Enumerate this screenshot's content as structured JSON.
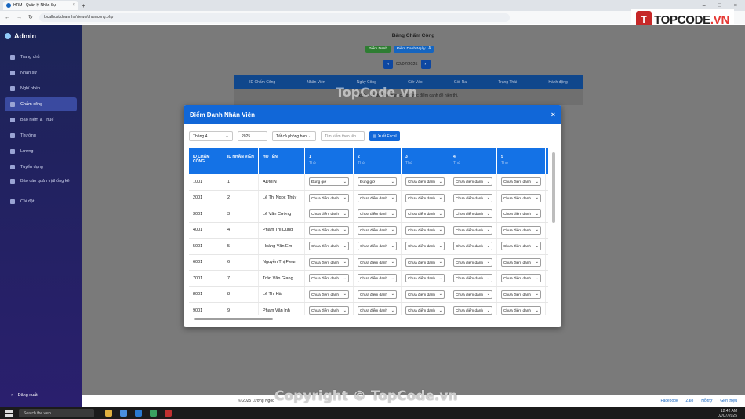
{
  "browser": {
    "tab_title": "HRM - Quản lý Nhân Sự",
    "url": "localhost/doannhs/views/chamcong.php"
  },
  "brand": {
    "logo_letter": "T",
    "text_a": "TOPCODE",
    "text_b": ".VN"
  },
  "sidebar": {
    "title": "Admin",
    "items": [
      {
        "label": "Trang chủ",
        "icon": "home-icon"
      },
      {
        "label": "Nhân sự",
        "icon": "users-icon"
      },
      {
        "label": "Nghỉ phép",
        "icon": "leave-icon"
      },
      {
        "label": "Chấm công",
        "icon": "calendar-icon",
        "active": true
      },
      {
        "label": "Bảo hiểm & Thuế",
        "icon": "insurance-icon"
      },
      {
        "label": "Thưởng",
        "icon": "gift-icon"
      },
      {
        "label": "Lương",
        "icon": "money-icon"
      },
      {
        "label": "Tuyển dụng",
        "icon": "recruit-icon"
      },
      {
        "label": "Báo cáo quản trị/thống kê",
        "icon": "chart-icon"
      },
      {
        "label": "Cài đặt",
        "icon": "gear-icon"
      }
    ],
    "logout": "Đăng xuất"
  },
  "page": {
    "title": "Bảng Chấm Công",
    "btn_attendance": "Điểm Danh",
    "btn_holiday": "Điểm Danh Ngày Lễ",
    "date": "02/07/2025",
    "bg_headers": [
      "ID Chấm Công",
      "Nhân Viên",
      "Ngày Công",
      "Giờ Vào",
      "Giờ Ra",
      "Trạng Thái",
      "Hành động"
    ],
    "bg_empty": "không có dữ liệu chấm công được điểm danh để hiển thị."
  },
  "modal": {
    "title": "Điểm Danh Nhân Viên",
    "close": "×",
    "month": "Tháng 4",
    "year": "2025",
    "department": "Tất cả phòng ban",
    "search_placeholder": "Tìm kiếm theo tên...",
    "export": "Xuất Excel",
    "headers": [
      "ID CHẤM CÔNG",
      "ID NHÂN VIÊN",
      "HỌ TÊN"
    ],
    "days": [
      {
        "day": "1",
        "wd": "Thứ"
      },
      {
        "day": "2",
        "wd": "Thứ"
      },
      {
        "day": "3",
        "wd": "Thứ"
      },
      {
        "day": "4",
        "wd": "Thứ"
      },
      {
        "day": "5",
        "wd": "Thứ"
      }
    ],
    "rows": [
      {
        "id": "1001",
        "emp": "1",
        "name": "ADMIN",
        "att": [
          "Đúng giờ",
          "Đúng giờ",
          "Chưa điểm danh",
          "Chưa điểm danh",
          "Chưa điểm danh"
        ]
      },
      {
        "id": "2001",
        "emp": "2",
        "name": "Lê Thị Ngọc Thủy",
        "att": [
          "Chưa điểm danh",
          "Chưa điểm danh",
          "Chưa điểm danh",
          "Chưa điểm danh",
          "Chưa điểm danh"
        ]
      },
      {
        "id": "3001",
        "emp": "3",
        "name": "Lê Văn Cường",
        "att": [
          "Chưa điểm danh",
          "Chưa điểm danh",
          "Chưa điểm danh",
          "Chưa điểm danh",
          "Chưa điểm danh"
        ]
      },
      {
        "id": "4001",
        "emp": "4",
        "name": "Phạm Thị Dung",
        "att": [
          "Chưa điểm danh",
          "Chưa điểm danh",
          "Chưa điểm danh",
          "Chưa điểm danh",
          "Chưa điểm danh"
        ]
      },
      {
        "id": "5001",
        "emp": "5",
        "name": "Hoàng Văn Em",
        "att": [
          "Chưa điểm danh",
          "Chưa điểm danh",
          "Chưa điểm danh",
          "Chưa điểm danh",
          "Chưa điểm danh"
        ]
      },
      {
        "id": "6001",
        "emp": "6",
        "name": "Nguyễn Thị Fleur",
        "att": [
          "Chưa điểm danh",
          "Chưa điểm danh",
          "Chưa điểm danh",
          "Chưa điểm danh",
          "Chưa điểm danh"
        ]
      },
      {
        "id": "7001",
        "emp": "7",
        "name": "Trần Văn Giang",
        "att": [
          "Chưa điểm danh",
          "Chưa điểm danh",
          "Chưa điểm danh",
          "Chưa điểm danh",
          "Chưa điểm danh"
        ]
      },
      {
        "id": "8001",
        "emp": "8",
        "name": "Lê Thị Hà",
        "att": [
          "Chưa điểm danh",
          "Chưa điểm danh",
          "Chưa điểm danh",
          "Chưa điểm danh",
          "Chưa điểm danh"
        ]
      },
      {
        "id": "9001",
        "emp": "9",
        "name": "Phạm Văn Inh",
        "att": [
          "Chưa điểm danh",
          "Chưa điểm danh",
          "Chưa điểm danh",
          "Chưa điểm danh",
          "Chưa điểm danh"
        ]
      }
    ]
  },
  "footer": {
    "copy": "© 2025 Lương Ngọc",
    "links": [
      "Facebook",
      "Zalo",
      "Hỗ trợ",
      "Giới thiệu"
    ]
  },
  "watermark": {
    "center": "TopCode.vn",
    "bottom": "Copyright © TopCode.vn"
  },
  "taskbar": {
    "search": "Search the web",
    "time": "12:42 AM",
    "date": "02/07/2025"
  }
}
